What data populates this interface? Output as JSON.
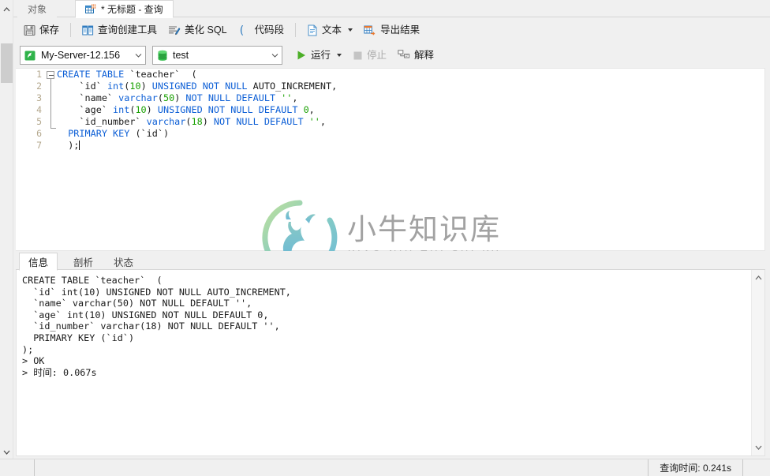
{
  "window": {
    "tabs": [
      {
        "label": "对象",
        "icon": "objects-icon",
        "active": false
      },
      {
        "label": "* 无标题 - 查询",
        "icon": "query-grid-icon",
        "active": true
      }
    ]
  },
  "toolbar_main": {
    "items": [
      {
        "label": "保存",
        "icon": "save-icon"
      },
      {
        "label": "查询创建工具",
        "icon": "query-builder-icon"
      },
      {
        "label": "美化 SQL",
        "icon": "beautify-sql-icon"
      },
      {
        "label": "代码段",
        "icon": "code-snippet-icon"
      },
      {
        "label": "文本",
        "icon": "text-icon",
        "has_dropdown": true
      },
      {
        "label": "导出结果",
        "icon": "export-result-icon"
      }
    ]
  },
  "toolbar_run": {
    "server": {
      "value": "My-Server-12.156",
      "icon": "server-icon"
    },
    "database": {
      "value": "test",
      "icon": "database-icon"
    },
    "run": {
      "label": "运行",
      "icon": "play-icon",
      "has_dropdown": true,
      "enabled": true
    },
    "stop": {
      "label": "停止",
      "icon": "stop-icon",
      "enabled": false
    },
    "explain": {
      "label": "解释",
      "icon": "explain-icon",
      "enabled": true
    }
  },
  "editor": {
    "line_numbers": [
      "1",
      "2",
      "3",
      "4",
      "5",
      "6",
      "7"
    ],
    "lines": [
      [
        {
          "t": "CREATE TABLE ",
          "c": "kw"
        },
        {
          "t": "`teacher`",
          "c": "idq"
        },
        {
          "t": "  (",
          "c": "plain"
        }
      ],
      [
        {
          "t": "    `id`",
          "c": "idq"
        },
        {
          "t": " ",
          "c": "plain"
        },
        {
          "t": "int",
          "c": "typ"
        },
        {
          "t": "(",
          "c": "plain"
        },
        {
          "t": "10",
          "c": "num"
        },
        {
          "t": ") ",
          "c": "plain"
        },
        {
          "t": "UNSIGNED NOT NULL",
          "c": "kw"
        },
        {
          "t": " AUTO_INCREMENT,",
          "c": "plain"
        }
      ],
      [
        {
          "t": "    `name`",
          "c": "idq"
        },
        {
          "t": " ",
          "c": "plain"
        },
        {
          "t": "varchar",
          "c": "typ"
        },
        {
          "t": "(",
          "c": "plain"
        },
        {
          "t": "50",
          "c": "num"
        },
        {
          "t": ") ",
          "c": "plain"
        },
        {
          "t": "NOT NULL DEFAULT",
          "c": "kw"
        },
        {
          "t": " ",
          "c": "plain"
        },
        {
          "t": "''",
          "c": "str"
        },
        {
          "t": ",",
          "c": "plain"
        }
      ],
      [
        {
          "t": "    `age`",
          "c": "idq"
        },
        {
          "t": " ",
          "c": "plain"
        },
        {
          "t": "int",
          "c": "typ"
        },
        {
          "t": "(",
          "c": "plain"
        },
        {
          "t": "10",
          "c": "num"
        },
        {
          "t": ") ",
          "c": "plain"
        },
        {
          "t": "UNSIGNED NOT NULL DEFAULT",
          "c": "kw"
        },
        {
          "t": " ",
          "c": "plain"
        },
        {
          "t": "0",
          "c": "num"
        },
        {
          "t": ",",
          "c": "plain"
        }
      ],
      [
        {
          "t": "    `id_number`",
          "c": "idq"
        },
        {
          "t": " ",
          "c": "plain"
        },
        {
          "t": "varchar",
          "c": "typ"
        },
        {
          "t": "(",
          "c": "plain"
        },
        {
          "t": "18",
          "c": "num"
        },
        {
          "t": ") ",
          "c": "plain"
        },
        {
          "t": "NOT NULL DEFAULT",
          "c": "kw"
        },
        {
          "t": " ",
          "c": "plain"
        },
        {
          "t": "''",
          "c": "str"
        },
        {
          "t": ",",
          "c": "plain"
        }
      ],
      [
        {
          "t": "  PRIMARY KEY",
          "c": "kw"
        },
        {
          "t": " (`id`)",
          "c": "idq"
        }
      ],
      [
        {
          "t": "  );",
          "c": "plain"
        }
      ]
    ]
  },
  "watermark": {
    "cn": "小牛知识库",
    "en": "XIAO NIU ZHI SHI KU"
  },
  "results": {
    "tabs": [
      {
        "label": "信息",
        "active": true
      },
      {
        "label": "剖析",
        "active": false
      },
      {
        "label": "状态",
        "active": false
      }
    ],
    "output": "CREATE TABLE `teacher`  (\n  `id` int(10) UNSIGNED NOT NULL AUTO_INCREMENT,\n  `name` varchar(50) NOT NULL DEFAULT '',\n  `age` int(10) UNSIGNED NOT NULL DEFAULT 0,\n  `id_number` varchar(18) NOT NULL DEFAULT '',\n  PRIMARY KEY (`id`)\n);\n> OK\n> 时间: 0.067s"
  },
  "statusbar": {
    "query_time": "查询时间: 0.241s"
  },
  "colors": {
    "accent_blue": "#0d5fd6",
    "string_green": "#18a000",
    "run_green": "#4caf28",
    "tab_active_bg": "#ffffff",
    "chrome_bg": "#f0f0f0"
  }
}
